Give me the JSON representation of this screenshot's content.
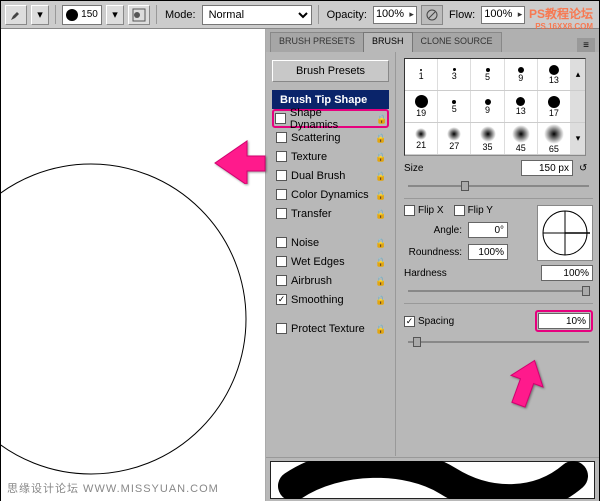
{
  "toolbar": {
    "brush_size": "150",
    "mode_label": "Mode:",
    "mode_value": "Normal",
    "opacity_label": "Opacity:",
    "opacity_value": "100%",
    "flow_label": "Flow:",
    "flow_value": "100%"
  },
  "panel": {
    "tabs": [
      "BRUSH PRESETS",
      "BRUSH",
      "CLONE SOURCE"
    ],
    "active_tab": 1,
    "presets_button": "Brush Presets",
    "items": [
      {
        "label": "Brush Tip Shape",
        "header": true
      },
      {
        "label": "Shape Dynamics",
        "checked": false,
        "lock": true,
        "highlight": true
      },
      {
        "label": "Scattering",
        "checked": false,
        "lock": true
      },
      {
        "label": "Texture",
        "checked": false,
        "lock": true
      },
      {
        "label": "Dual Brush",
        "checked": false,
        "lock": true
      },
      {
        "label": "Color Dynamics",
        "checked": false,
        "lock": true
      },
      {
        "label": "Transfer",
        "checked": false,
        "lock": true
      },
      {
        "label": "",
        "empty": true
      },
      {
        "label": "Noise",
        "checked": false,
        "lock": true
      },
      {
        "label": "Wet Edges",
        "checked": false,
        "lock": true
      },
      {
        "label": "Airbrush",
        "checked": false,
        "lock": true
      },
      {
        "label": "Smoothing",
        "checked": true,
        "lock": true
      },
      {
        "label": "",
        "empty": true
      },
      {
        "label": "Protect Texture",
        "checked": false,
        "lock": true
      }
    ]
  },
  "brush_grid": {
    "rows": [
      {
        "sizes": [
          1,
          3,
          5,
          9,
          13
        ],
        "style": "hard"
      },
      {
        "sizes": [
          19,
          5,
          9,
          13,
          17
        ],
        "style": "hard"
      },
      {
        "sizes": [
          21,
          27,
          35,
          45,
          65
        ],
        "style": "soft"
      }
    ]
  },
  "settings": {
    "size_label": "Size",
    "size_value": "150 px",
    "flipx": "Flip X",
    "flipx_checked": false,
    "flipy": "Flip Y",
    "flipy_checked": false,
    "angle_label": "Angle:",
    "angle_value": "0°",
    "roundness_label": "Roundness:",
    "roundness_value": "100%",
    "hardness_label": "Hardness",
    "hardness_value": "100%",
    "spacing_label": "Spacing",
    "spacing_checked": true,
    "spacing_value": "10%"
  },
  "watermark": {
    "left": "思缘设计论坛  WWW.MISSYUAN.COM",
    "right_top": "PS教程论坛",
    "right_bottom": "PS.16XX8.COM"
  }
}
